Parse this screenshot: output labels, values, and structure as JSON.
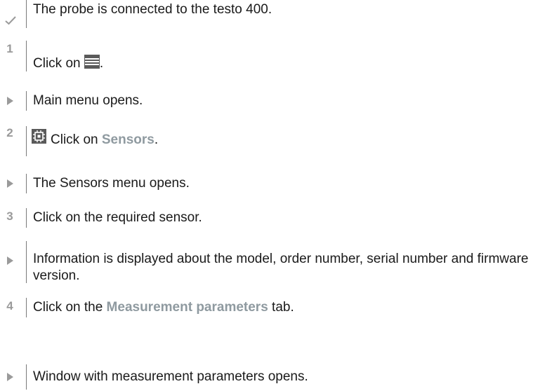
{
  "prerequisite": {
    "icon": "checkmark-icon",
    "text": "The probe is connected to the testo 400."
  },
  "steps": [
    {
      "number": "1",
      "text_before": "Click on ",
      "icon": "menu-icon",
      "text_after": "."
    },
    {
      "type": "result",
      "icon": "arrow-right-icon",
      "text": "Main menu opens."
    },
    {
      "number": "2",
      "icon": "sensor-chip-icon",
      "text_before": "Click on ",
      "bold": "Sensors",
      "text_after": "."
    },
    {
      "type": "result",
      "icon": "arrow-right-icon",
      "text": "The Sensors menu opens."
    },
    {
      "number": "3",
      "text": "Click on the required sensor."
    },
    {
      "type": "result",
      "icon": "arrow-right-icon",
      "text": "Information is displayed about the model, order number, serial number and firmware version."
    },
    {
      "number": "4",
      "text_before": "Click on the ",
      "bold": "Measurement parameters",
      "text_after": " tab."
    },
    {
      "type": "result",
      "icon": "arrow-right-icon",
      "text": "Window with measurement parameters opens."
    }
  ],
  "colors": {
    "marker": "#9a9a9a",
    "bold_text": "#8f9aa0",
    "bar": "#7a7a7a",
    "icon": "#5a5a5a"
  }
}
